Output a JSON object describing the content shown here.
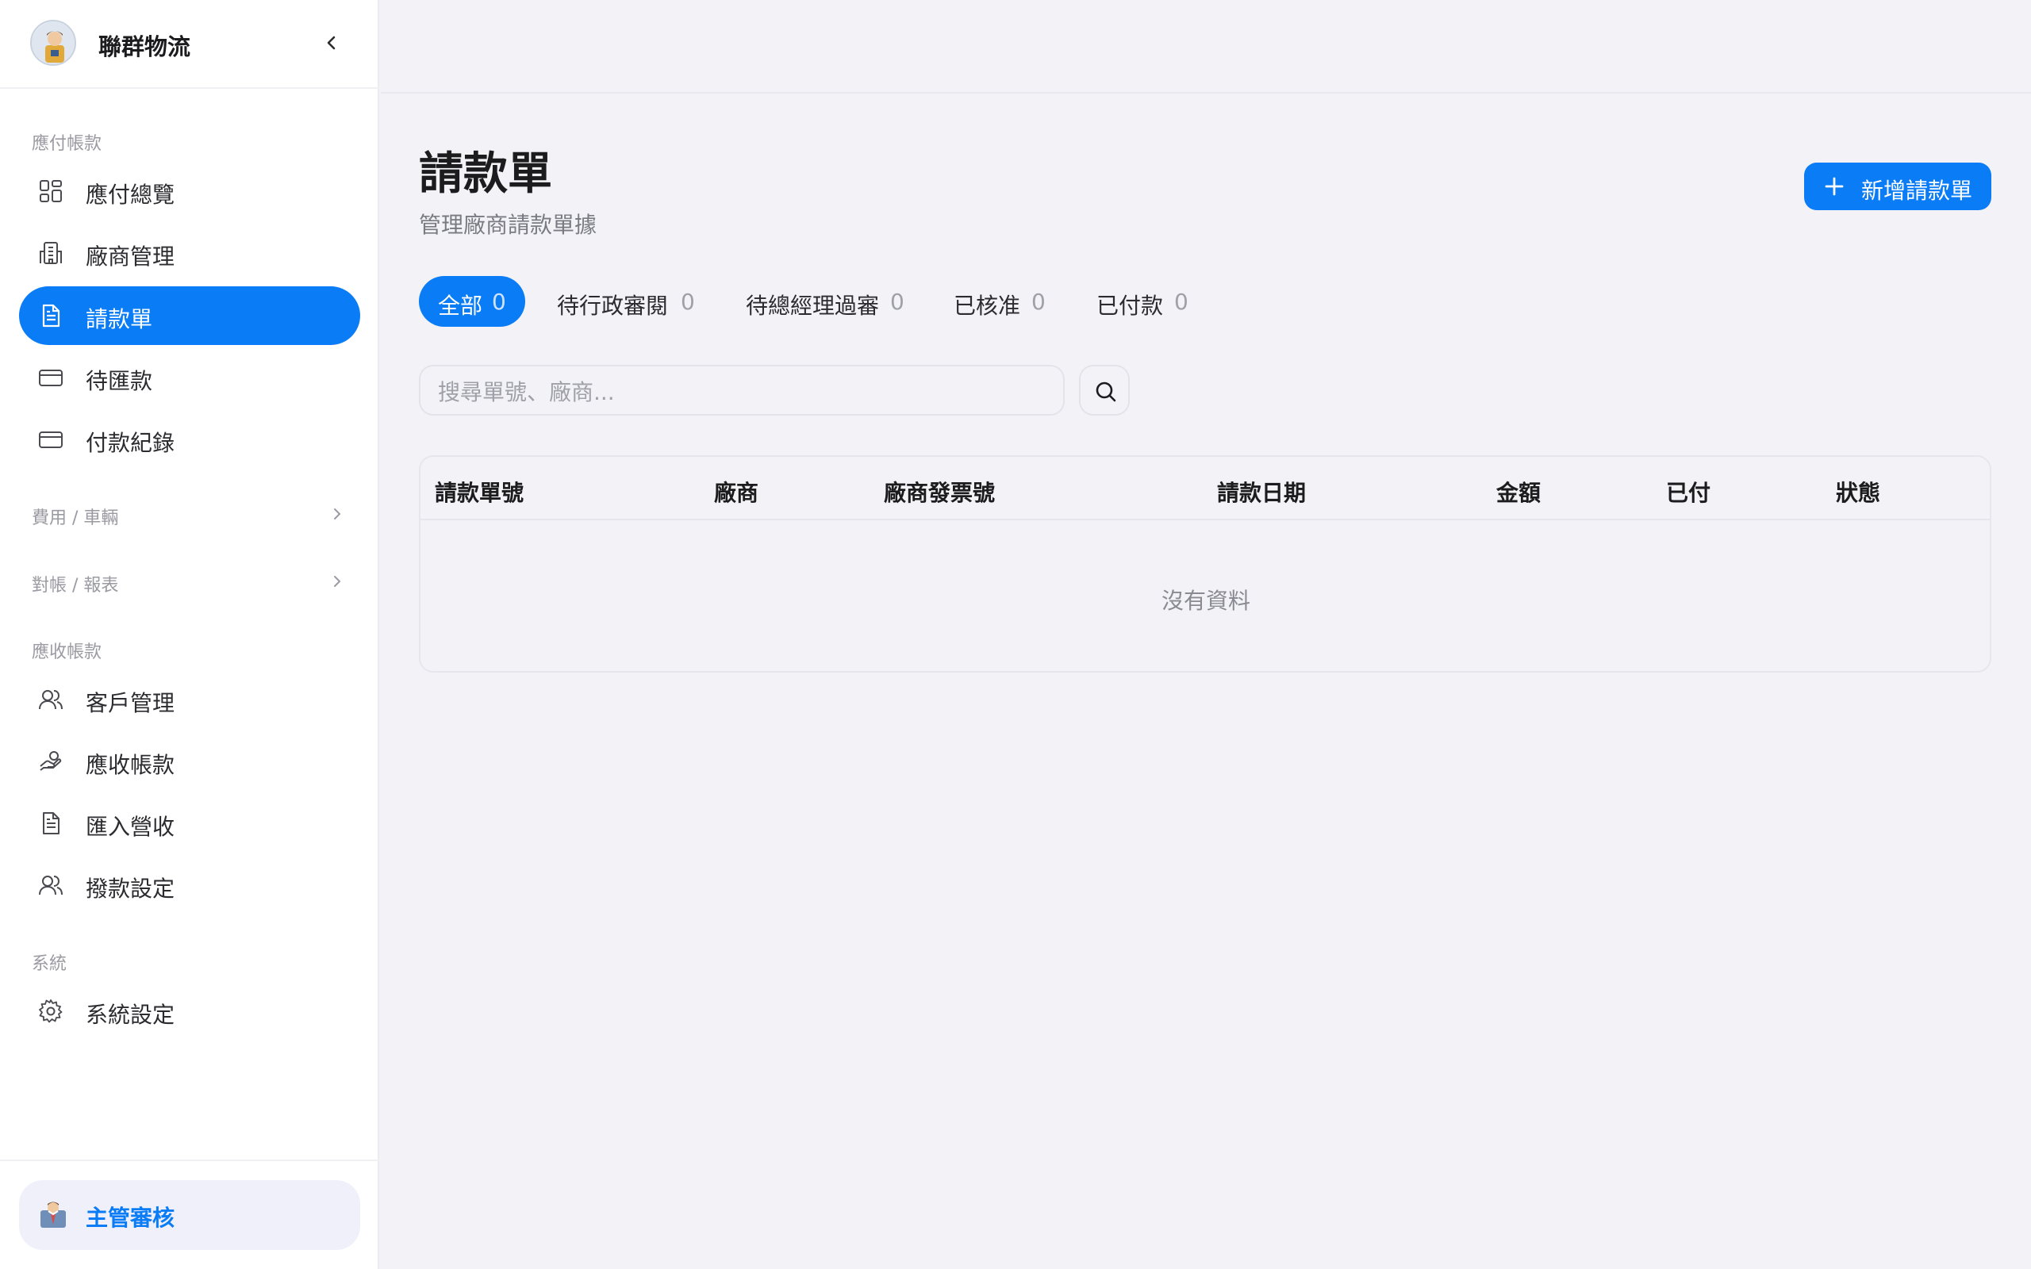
{
  "brand": {
    "name": "聯群物流"
  },
  "sidebar": {
    "sections": [
      {
        "label": "應付帳款"
      },
      {
        "label": "費用 / 車輛"
      },
      {
        "label": "對帳 / 報表"
      },
      {
        "label": "應收帳款"
      },
      {
        "label": "系統"
      }
    ],
    "items": [
      {
        "label": "應付總覽",
        "icon": "dashboard-grid-icon"
      },
      {
        "label": "廠商管理",
        "icon": "building-icon"
      },
      {
        "label": "請款單",
        "icon": "document-icon",
        "active": true
      },
      {
        "label": "待匯款",
        "icon": "credit-card-icon"
      },
      {
        "label": "付款紀錄",
        "icon": "credit-card-icon"
      },
      {
        "label": "客戶管理",
        "icon": "users-icon"
      },
      {
        "label": "應收帳款",
        "icon": "hand-coin-icon"
      },
      {
        "label": "匯入營收",
        "icon": "document-icon"
      },
      {
        "label": "撥款設定",
        "icon": "users-icon"
      },
      {
        "label": "系統設定",
        "icon": "gear-icon"
      }
    ],
    "role": {
      "label": "主管審核",
      "icon": "manager-emoji-icon"
    }
  },
  "page": {
    "title": "請款單",
    "subtitle": "管理廠商請款單據",
    "add_button": "新增請款單"
  },
  "tabs": [
    {
      "label": "全部",
      "count": "0",
      "active": true
    },
    {
      "label": "待行政審閱",
      "count": "0"
    },
    {
      "label": "待總經理過審",
      "count": "0"
    },
    {
      "label": "已核准",
      "count": "0"
    },
    {
      "label": "已付款",
      "count": "0"
    }
  ],
  "search": {
    "placeholder": "搜尋單號、廠商..."
  },
  "table": {
    "columns": [
      "請款單號",
      "廠商",
      "廠商發票號",
      "請款日期",
      "金額",
      "已付",
      "狀態"
    ],
    "empty_text": "沒有資料"
  },
  "colors": {
    "accent": "#0a7cf5",
    "background": "#f2f2f7",
    "sidebar": "#ffffff"
  }
}
